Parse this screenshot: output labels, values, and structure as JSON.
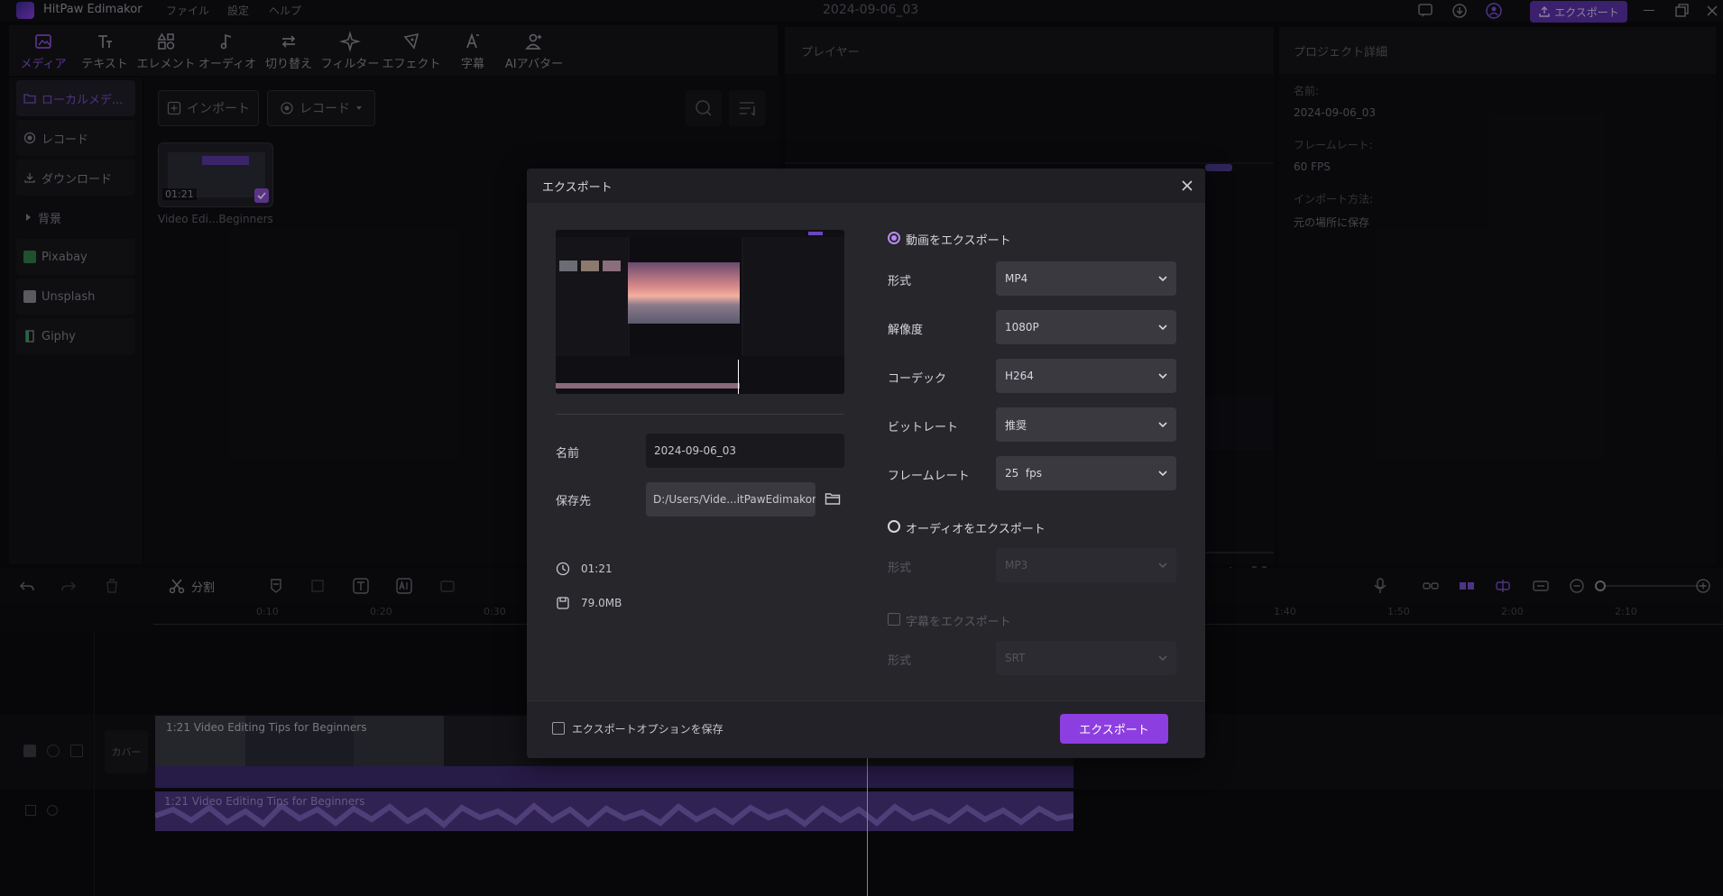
{
  "titlebar": {
    "app_name": "HitPaw Edimakor",
    "menu": [
      "ファイル",
      "設定",
      "ヘルプ"
    ],
    "project_title": "2024-09-06_03",
    "export_label": "エクスポート"
  },
  "tools": [
    {
      "label": "メディア",
      "icon": "media-icon",
      "active": true
    },
    {
      "label": "テキスト",
      "icon": "text-icon"
    },
    {
      "label": "エレメント",
      "icon": "element-icon"
    },
    {
      "label": "オーディオ",
      "icon": "audio-icon"
    },
    {
      "label": "切り替え",
      "icon": "transition-icon"
    },
    {
      "label": "フィルター",
      "icon": "filter-icon"
    },
    {
      "label": "エフェクト",
      "icon": "effect-icon"
    },
    {
      "label": "字幕",
      "icon": "subtitle-icon"
    },
    {
      "label": "AIアバター",
      "icon": "avatar-icon"
    }
  ],
  "leftnav": [
    {
      "label": "ローカルメデ...",
      "active": true
    },
    {
      "label": "レコード"
    },
    {
      "label": "ダウンロード"
    },
    {
      "label": "背景"
    },
    {
      "label": "Pixabay"
    },
    {
      "label": "Unsplash"
    },
    {
      "label": "Giphy"
    }
  ],
  "media": {
    "import_label": "インポート",
    "record_label": "レコード",
    "thumb_duration": "01:21",
    "thumb_caption": "Video Edi...Beginners"
  },
  "player": {
    "title": "プレイヤー"
  },
  "project": {
    "title": "プロジェクト詳細",
    "name_label": "名前:",
    "name_value": "2024-09-06_03",
    "framerate_label": "フレームレート:",
    "framerate_value": "60 FPS",
    "import_label": "インポート方法:",
    "import_value": "元の場所に保存"
  },
  "timeline": {
    "split_label": "分割",
    "ruler": [
      "0:10",
      "0:20",
      "0:30",
      "1:40",
      "1:50",
      "2:00",
      "2:10"
    ],
    "cover_label": "カバー",
    "video_clip": "1:21 Video Editing Tips for Beginners",
    "audio_clip": "1:21 Video Editing Tips for Beginners"
  },
  "dialog": {
    "title": "エクスポート",
    "name_label": "名前",
    "name_value": "2024-09-06_03",
    "save_label": "保存先",
    "save_path": "D:/Users/Vide...itPawEdimakor",
    "duration": "01:21",
    "size": "79.0MB",
    "export_video": "動画をエクスポート",
    "format_label": "形式",
    "format_value": "MP4",
    "resolution_label": "解像度",
    "resolution_value": "1080P",
    "codec_label": "コーデック",
    "codec_value": "H264",
    "bitrate_label": "ビットレート",
    "bitrate_value": "推奨",
    "framerate_label": "フレームレート",
    "framerate_value": "25  fps",
    "export_audio": "オーディオをエクスポート",
    "audio_format_label": "形式",
    "audio_format_value": "MP3",
    "export_subtitle": "字幕をエクスポート",
    "subtitle_format_label": "形式",
    "subtitle_format_value": "SRT",
    "save_options": "エクスポートオプションを保存",
    "export_button": "エクスポート"
  },
  "colors": {
    "accent": "#8d3ee0",
    "dialog_bg": "#27262b",
    "app_bg": "#0c0c10"
  }
}
